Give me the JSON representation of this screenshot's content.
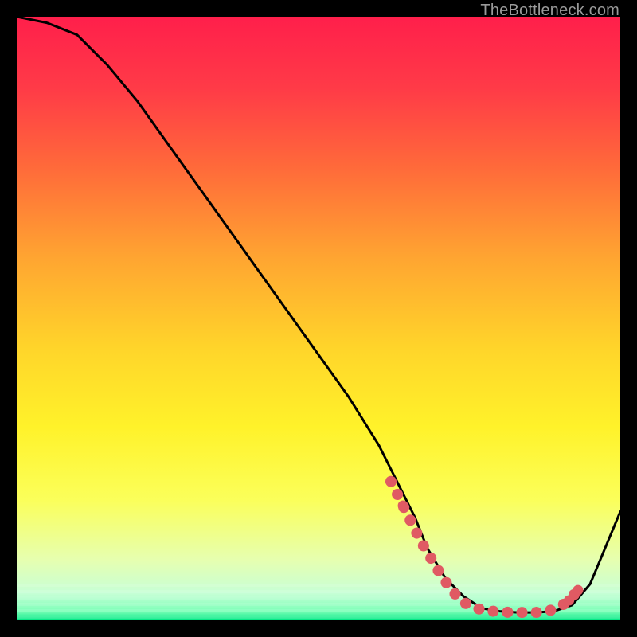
{
  "watermark": "TheBottleneck.com",
  "chart_data": {
    "type": "line",
    "title": "",
    "xlabel": "",
    "ylabel": "",
    "xlim": [
      0,
      100
    ],
    "ylim": [
      0,
      100
    ],
    "gradient_stops": [
      {
        "offset": 0.0,
        "color": "#ff1f4b"
      },
      {
        "offset": 0.12,
        "color": "#ff3b47"
      },
      {
        "offset": 0.25,
        "color": "#ff6a3a"
      },
      {
        "offset": 0.4,
        "color": "#ffa531"
      },
      {
        "offset": 0.55,
        "color": "#ffd52a"
      },
      {
        "offset": 0.68,
        "color": "#fff22a"
      },
      {
        "offset": 0.8,
        "color": "#fbff5a"
      },
      {
        "offset": 0.9,
        "color": "#e6ffb0"
      },
      {
        "offset": 0.955,
        "color": "#c7ffd6"
      },
      {
        "offset": 0.985,
        "color": "#7dffb8"
      },
      {
        "offset": 1.0,
        "color": "#00e884"
      }
    ],
    "series": [
      {
        "name": "curve",
        "x": [
          0,
          5,
          10,
          15,
          20,
          25,
          30,
          35,
          40,
          45,
          50,
          55,
          60,
          62,
          64,
          66,
          68,
          71,
          74,
          77,
          80,
          83,
          86,
          89,
          92,
          95,
          100
        ],
        "y": [
          100,
          99,
          97,
          92,
          86,
          79,
          72,
          65,
          58,
          51,
          44,
          37,
          29,
          25,
          21,
          17,
          12,
          7,
          4,
          2,
          1.5,
          1.3,
          1.3,
          1.5,
          2.5,
          6,
          18
        ]
      }
    ],
    "markers": {
      "name": "highlight",
      "color": "#e05a63",
      "x": [
        62,
        64,
        67,
        70,
        72,
        74,
        76,
        78,
        80,
        82,
        84,
        86,
        88,
        90,
        91.5,
        93
      ],
      "y": [
        23,
        19,
        13,
        8,
        5,
        3,
        2,
        1.6,
        1.4,
        1.3,
        1.3,
        1.3,
        1.5,
        2.2,
        3.3,
        5
      ]
    }
  }
}
